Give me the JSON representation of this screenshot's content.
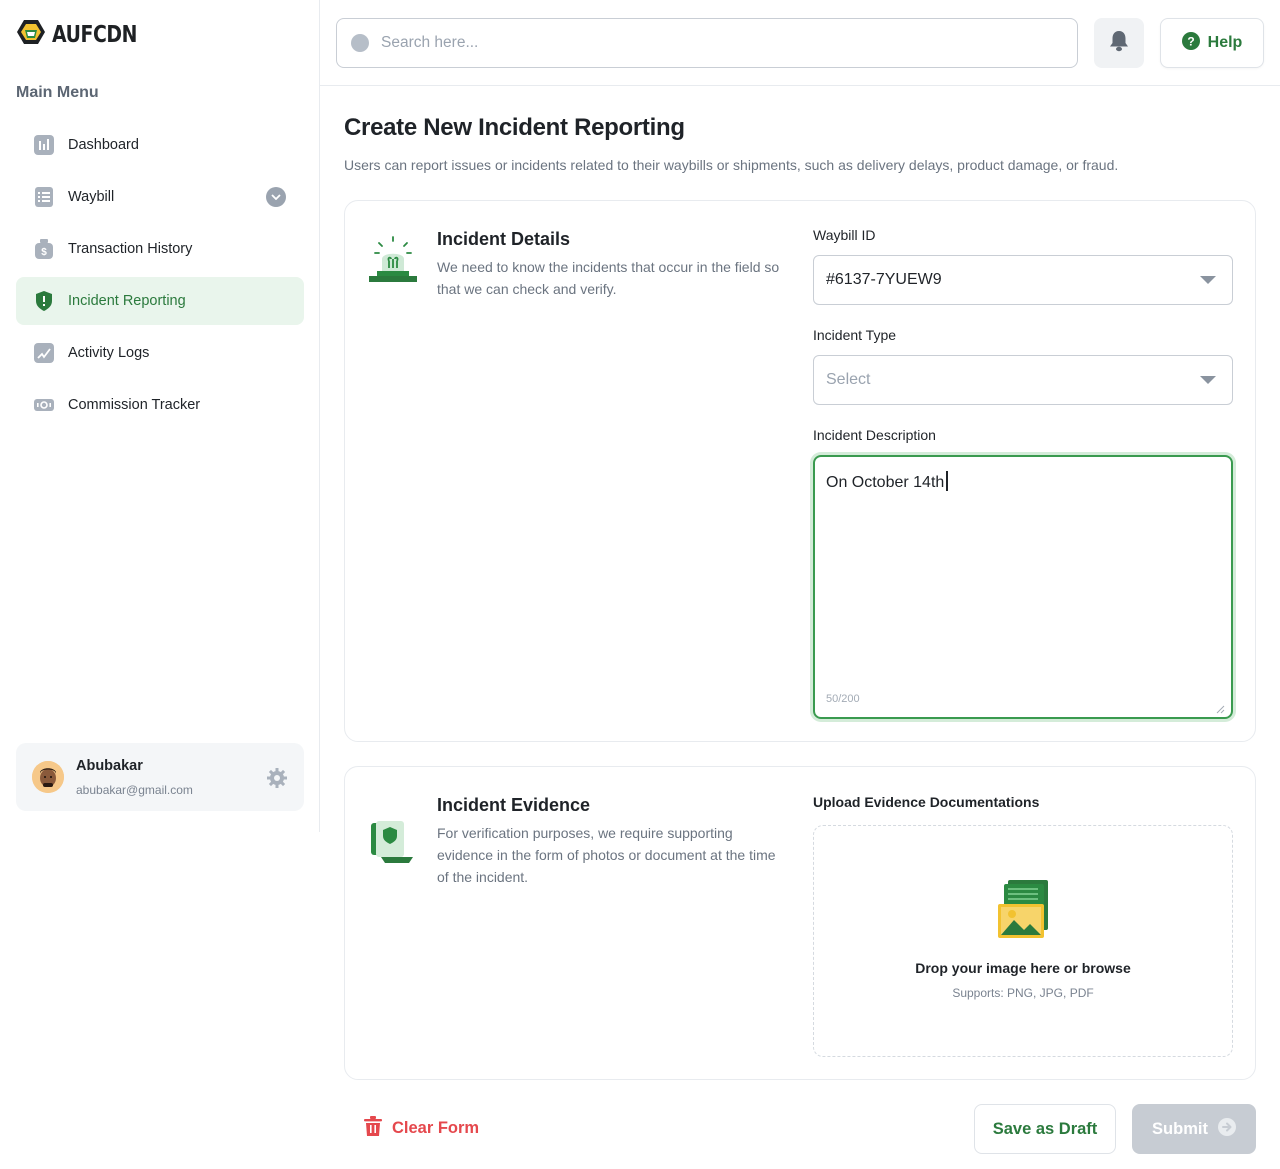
{
  "brand": {
    "name": "AUFCDN"
  },
  "sidebar": {
    "menu_title": "Main Menu",
    "items": [
      {
        "label": "Dashboard",
        "icon": "bar-chart-icon"
      },
      {
        "label": "Waybill",
        "icon": "list-icon",
        "expandable": true
      },
      {
        "label": "Transaction History",
        "icon": "money-bag-icon"
      },
      {
        "label": "Incident Reporting",
        "icon": "shield-alert-icon",
        "active": true
      },
      {
        "label": "Activity Logs",
        "icon": "activity-icon"
      },
      {
        "label": "Commission Tracker",
        "icon": "cash-icon"
      }
    ],
    "user": {
      "name": "Abubakar",
      "email": "abubakar@gmail.com"
    }
  },
  "topbar": {
    "search_placeholder": "Search here...",
    "help_label": "Help"
  },
  "page": {
    "title": "Create New Incident Reporting",
    "subtitle": "Users can report issues or incidents related to their waybills or shipments, such as delivery delays, product damage, or fraud."
  },
  "incident_details": {
    "title": "Incident Details",
    "description": "We need to know the incidents that occur in the field so that we can check and verify.",
    "waybill_label": "Waybill ID",
    "waybill_value": "#6137-7YUEW9",
    "type_label": "Incident Type",
    "type_placeholder": "Select",
    "desc_label": "Incident Description",
    "desc_value": "On October 14th",
    "desc_counter": "50/200"
  },
  "incident_evidence": {
    "title": "Incident Evidence",
    "description": "For verification purposes, we require supporting evidence in the form of photos or document at the time of the incident.",
    "upload_label": "Upload Evidence Documentations",
    "drop_title": "Drop your image here or browse",
    "drop_sub": "Supports: PNG, JPG, PDF"
  },
  "actions": {
    "clear_label": "Clear Form",
    "draft_label": "Save as Draft",
    "submit_label": "Submit"
  },
  "colors": {
    "brand_green": "#2b7a3d",
    "active_bg": "#e9f5ec",
    "danger": "#e5484d",
    "disabled": "#c7ccd3"
  }
}
